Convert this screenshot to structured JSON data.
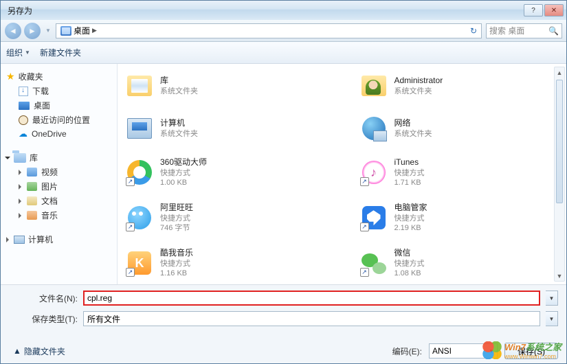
{
  "window": {
    "title": "另存为"
  },
  "nav": {
    "location_icon_label": "桌面",
    "location": "桌面",
    "search_placeholder": "搜索 桌面"
  },
  "toolbar": {
    "organize": "组织",
    "new_folder": "新建文件夹"
  },
  "sidebar": {
    "favorites": {
      "label": "收藏夹",
      "items": [
        {
          "label": "下载"
        },
        {
          "label": "桌面"
        },
        {
          "label": "最近访问的位置"
        },
        {
          "label": "OneDrive"
        }
      ]
    },
    "libraries": {
      "label": "库",
      "items": [
        {
          "label": "视频"
        },
        {
          "label": "图片"
        },
        {
          "label": "文档"
        },
        {
          "label": "音乐"
        }
      ]
    },
    "computer": {
      "label": "计算机"
    }
  },
  "items": [
    {
      "name": "库",
      "sub1": "系统文件夹",
      "sub2": "",
      "icon": "libraries"
    },
    {
      "name": "Administrator",
      "sub1": "系统文件夹",
      "sub2": "",
      "icon": "user"
    },
    {
      "name": "计算机",
      "sub1": "系统文件夹",
      "sub2": "",
      "icon": "computer"
    },
    {
      "name": "网络",
      "sub1": "系统文件夹",
      "sub2": "",
      "icon": "network"
    },
    {
      "name": "360驱动大师",
      "sub1": "快捷方式",
      "sub2": "1.00 KB",
      "icon": "360",
      "shortcut": true
    },
    {
      "name": "iTunes",
      "sub1": "快捷方式",
      "sub2": "1.71 KB",
      "icon": "itunes",
      "shortcut": true
    },
    {
      "name": "阿里旺旺",
      "sub1": "快捷方式",
      "sub2": "746 字节",
      "icon": "aliww",
      "shortcut": true
    },
    {
      "name": "电脑管家",
      "sub1": "快捷方式",
      "sub2": "2.19 KB",
      "icon": "qqmgr",
      "shortcut": true
    },
    {
      "name": "酷我音乐",
      "sub1": "快捷方式",
      "sub2": "1.16 KB",
      "icon": "kuwo",
      "shortcut": true
    },
    {
      "name": "微信",
      "sub1": "快捷方式",
      "sub2": "1.08 KB",
      "icon": "wechat",
      "shortcut": true
    }
  ],
  "bottom": {
    "filename_label": "文件名(N):",
    "filename_value": "cpl.reg",
    "filetype_label": "保存类型(T):",
    "filetype_value": "所有文件",
    "hide_folders": "隐藏文件夹",
    "encoding_label": "编码(E):",
    "encoding_value": "ANSI",
    "save_btn": "保存(S)"
  },
  "watermark": {
    "brand_a": "Win7",
    "brand_b": "系统之家",
    "url": "www.Winwin7.com"
  }
}
